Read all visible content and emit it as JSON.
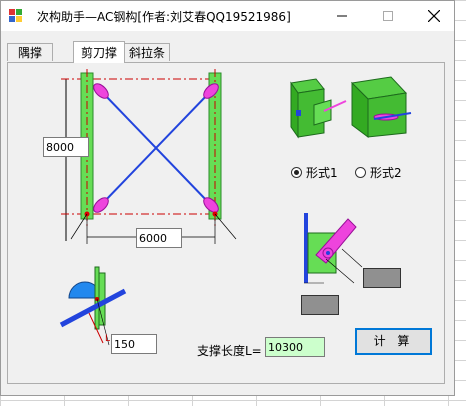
{
  "window": {
    "title": "次构助手—AC钢构[作者:刘艾春QQ19521986]",
    "controls": [
      "minimize-icon",
      "maximize-icon",
      "close-icon"
    ]
  },
  "tabs": [
    {
      "label": "隅撑",
      "active": false
    },
    {
      "label": "剪刀撑",
      "active": true
    },
    {
      "label": "斜拉条",
      "active": false
    }
  ],
  "inputs": {
    "height": "8000",
    "width": "6000",
    "offset": "150",
    "brace_length": "10300"
  },
  "labels": {
    "brace_length": "支撑长度L=",
    "offset_marker": "L"
  },
  "radios": [
    {
      "label": "形式1",
      "checked": true
    },
    {
      "label": "形式2",
      "checked": false
    }
  ],
  "buttons": {
    "calculate": "计 算"
  },
  "colors": {
    "column_green": "#66dd55",
    "brace_blue": "#2244dd",
    "plate_magenta": "#ee44dd",
    "dim_red": "#cc0000",
    "result_bg": "#ccffcc",
    "accent": "#0078d7"
  }
}
